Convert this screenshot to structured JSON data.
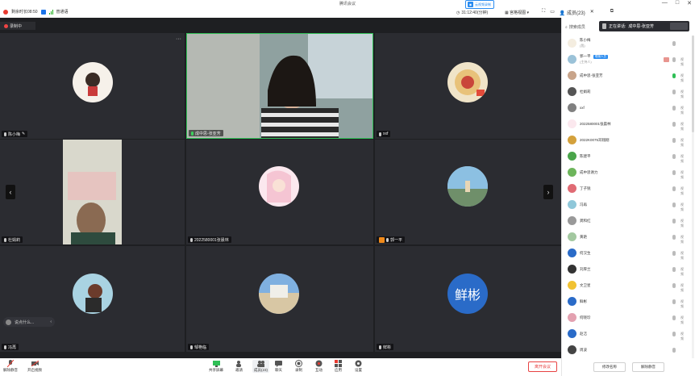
{
  "window": {
    "title": "腾讯会议",
    "minimize": "—",
    "maximize": "□",
    "close": "✕"
  },
  "meeting": {
    "duration": "剩余时长08:50",
    "mode": "普通语",
    "record_badge": "云视频录制",
    "timer": "31:12:40(分钟)",
    "gallery_view": "宫格视图",
    "members_tab": "成员(23)"
  },
  "recording": {
    "label": "录制中"
  },
  "tiles": [
    {
      "name": "陈小梅",
      "avatar_color": "#f6f1ea"
    },
    {
      "name": "成中思-张亚芳",
      "avatar_color": "#ffffff"
    },
    {
      "name": "xxf",
      "avatar_color": "#f0e4c8"
    },
    {
      "name": "杜娟莉",
      "avatar_color": "#ffffff"
    },
    {
      "name": "2022580001张晨林",
      "avatar_color": "#fbe8ee"
    },
    {
      "name": "郭一平",
      "avatar_color": "#9bc2d8"
    },
    {
      "name": "冯再",
      "avatar_color": "#a9d3e2"
    },
    {
      "name": "邹艳临",
      "avatar_color": "#6f98c7"
    },
    {
      "name": "鲜彬",
      "avatar_text": "鲜彬",
      "avatar_color": "#2a6bc8"
    }
  ],
  "chat_bubble": {
    "text": "说点什么..."
  },
  "toolbar": {
    "unmute": "解除静音",
    "start_video": "开启视频",
    "share_screen": "共享屏幕",
    "invite": "邀请",
    "members": "成员(23)",
    "chat": "聊天",
    "record": "录制",
    "apps": "应用",
    "settings": "设置",
    "extra1": "互动",
    "end_meeting": "离开会议"
  },
  "panel": {
    "search_placeholder": "搜索成员",
    "speaking_prefix": "正在讲话:",
    "speaking_name": "成中思-张亚芳",
    "footer_rename": "修改名称",
    "footer_unmute_all": "解除静音"
  },
  "members": [
    {
      "name": "陈小梅",
      "sub": "(我)",
      "color": "#f4ede0",
      "mic": "grey",
      "cam": ""
    },
    {
      "name": "郭一平",
      "sub": "(主持人)",
      "badge": "联席人员",
      "color": "#9bc2d8",
      "mic": "grey",
      "cam": "视频"
    },
    {
      "name": "成中思-张亚芳",
      "color": "#c8a48a",
      "mic": "green",
      "cam": "视频"
    },
    {
      "name": "杜娟莉",
      "color": "#555555",
      "mic": "grey",
      "cam": "视频"
    },
    {
      "name": "xxf",
      "color": "#808080",
      "mic": "grey",
      "cam": "视频"
    },
    {
      "name": "2022580001张晨林",
      "color": "#fbe8ee",
      "mic": "grey",
      "cam": "视频"
    },
    {
      "name": "2022K0075邓翔刚",
      "color": "#d4a13c",
      "mic": "grey",
      "cam": "视频"
    },
    {
      "name": "陈建平",
      "color": "#4aa54a",
      "mic": "grey",
      "cam": "视频"
    },
    {
      "name": "成中思谢力",
      "color": "#6db55b",
      "mic": "grey",
      "cam": "视频"
    },
    {
      "name": "丁子锐",
      "color": "#e06b74",
      "mic": "grey",
      "cam": "视频"
    },
    {
      "name": "冯再",
      "color": "#8fc7d9",
      "mic": "grey",
      "cam": "视频"
    },
    {
      "name": "龚和红",
      "color": "#999999",
      "mic": "grey",
      "cam": "视频"
    },
    {
      "name": "黄艳",
      "color": "#a3c8a0",
      "mic": "grey",
      "cam": "视频"
    },
    {
      "name": "何汉生",
      "color": "#2a6bc8",
      "mic": "grey",
      "cam": "视频"
    },
    {
      "name": "刘厚兰",
      "color": "#333333",
      "mic": "grey",
      "cam": "视频"
    },
    {
      "name": "文卫星",
      "color": "#f1c232",
      "mic": "grey",
      "cam": "视频"
    },
    {
      "name": "鲜彬",
      "color": "#2a6bc8",
      "mic": "grey",
      "cam": "视频"
    },
    {
      "name": "何晓珍",
      "color": "#e3a1b0",
      "mic": "grey",
      "cam": "视频"
    },
    {
      "name": "赵洁",
      "color": "#2a6bc8",
      "mic": "grey",
      "cam": "视频"
    },
    {
      "name": "周波",
      "color": "#444444",
      "mic": "grey",
      "cam": ""
    }
  ]
}
